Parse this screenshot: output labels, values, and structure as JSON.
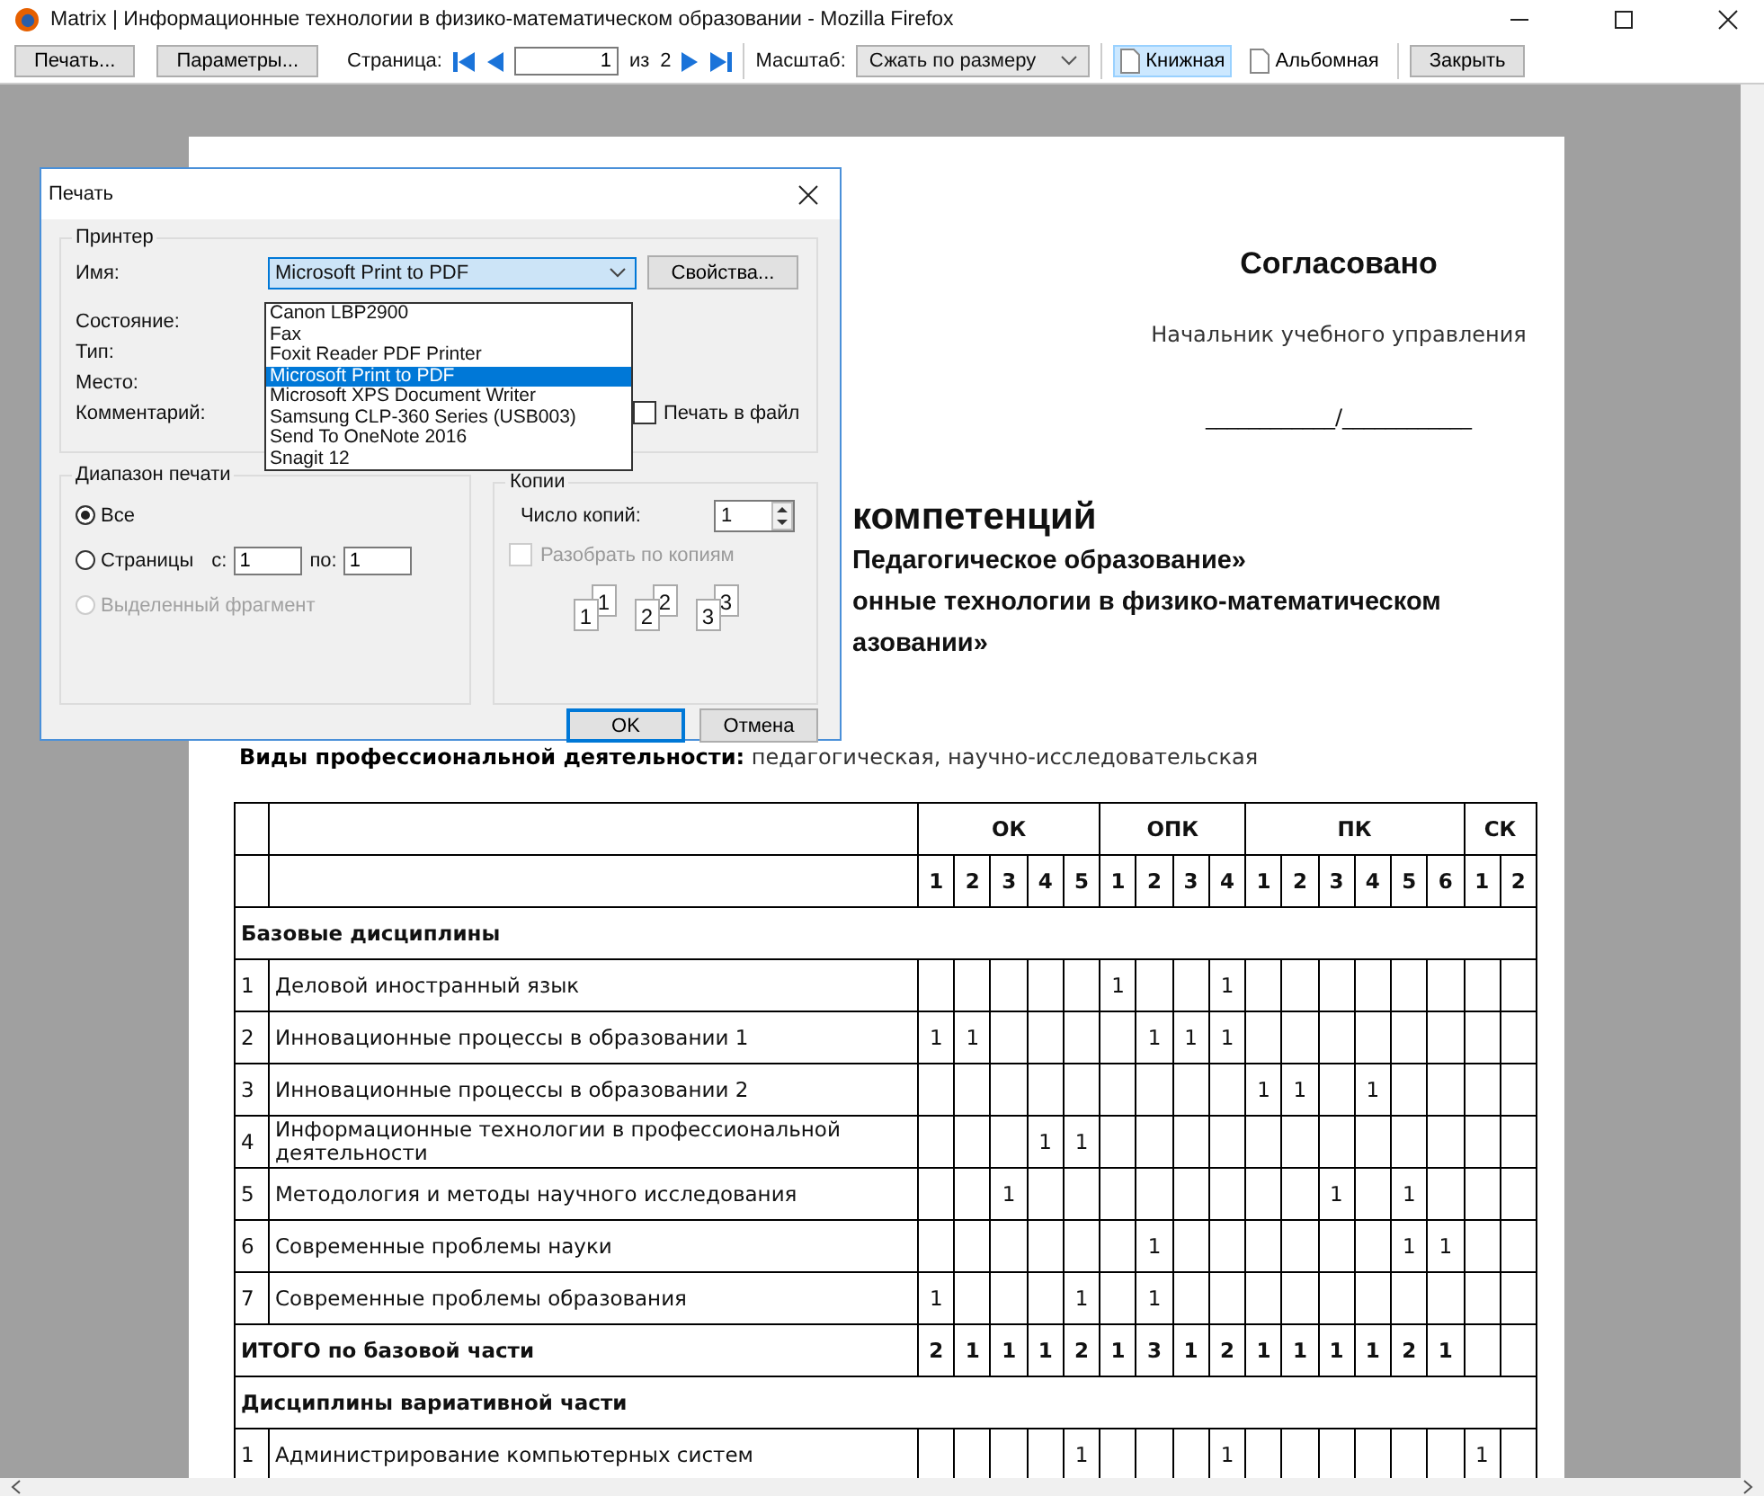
{
  "window": {
    "title": "Matrix | Информационные технологии в физико-математическом образовании - Mozilla Firefox"
  },
  "toolbar": {
    "print_button": "Печать...",
    "setup_button": "Параметры...",
    "page_label": "Страница:",
    "page_value": "1",
    "of_label": "из",
    "page_count": "2",
    "scale_label": "Масштаб:",
    "scale_value": "Сжать по размеру",
    "orientations": [
      {
        "label": "Книжная",
        "selected": true
      },
      {
        "label": "Альбомная",
        "selected": false
      }
    ],
    "close_button": "Закрыть"
  },
  "print_dialog": {
    "title": "Печать",
    "printer_group": "Принтер",
    "name_label": "Имя:",
    "printer": "Microsoft Print to PDF",
    "properties_button": "Свойства...",
    "info_labels": [
      "Состояние:",
      "Тип:",
      "Место:",
      "Комментарий:"
    ],
    "printer_options": [
      {
        "label": "Canon LBP2900",
        "selected": false
      },
      {
        "label": "Fax",
        "selected": false
      },
      {
        "label": "Foxit Reader PDF Printer",
        "selected": false
      },
      {
        "label": "Microsoft Print to PDF",
        "selected": true
      },
      {
        "label": "Microsoft XPS Document Writer",
        "selected": false
      },
      {
        "label": "Samsung CLP-360 Series (USB003)",
        "selected": false
      },
      {
        "label": "Send To OneNote 2016",
        "selected": false
      },
      {
        "label": "Snagit 12",
        "selected": false
      }
    ],
    "print_to_file": {
      "label": "Печать в файл",
      "checked": false
    },
    "range_group": "Диапазон печати",
    "range_options": [
      {
        "label": "Все",
        "selected": true,
        "disabled": false
      },
      {
        "label": "Страницы",
        "selected": false,
        "disabled": false
      },
      {
        "label": "Выделенный фрагмент",
        "selected": false,
        "disabled": true
      }
    ],
    "from_label": "с:",
    "from_value": "1",
    "to_label": "по:",
    "to_value": "1",
    "copies_group": "Копии",
    "copies_label": "Число копий:",
    "copies_value": "1",
    "collate": {
      "label": "Разобрать по копиям",
      "checked": false,
      "disabled": true
    },
    "collate_sets": [
      [
        "1",
        "1"
      ],
      [
        "2",
        "2"
      ],
      [
        "3",
        "3"
      ]
    ],
    "ok_button": "OK",
    "cancel_button": "Отмена"
  },
  "document": {
    "approval_title": "Согласовано",
    "approver": "Начальник учебного управления",
    "signature_line": "____________/____________",
    "heading_fragments": [
      "компетенций",
      "Педагогическое образование»",
      "онные технологии в физико-математическом",
      "азовании»"
    ],
    "activities": "**Виды профессиональной деятельности:** педагогическая, научно-исследовательская",
    "table": {
      "groups": [
        {
          "label": "ОК",
          "numbers": [
            "1",
            "2",
            "3",
            "4",
            "5"
          ]
        },
        {
          "label": "ОПК",
          "numbers": [
            "1",
            "2",
            "3",
            "4"
          ]
        },
        {
          "label": "ПК",
          "numbers": [
            "1",
            "2",
            "3",
            "4",
            "5",
            "6"
          ]
        },
        {
          "label": "СК",
          "numbers": [
            "1",
            "2"
          ]
        }
      ],
      "rows": [
        {
          "kind": "section",
          "label": "Базовые дисциплины"
        },
        {
          "kind": "item",
          "number": "1",
          "name": "Деловой иностранный язык",
          "cells": [
            null,
            null,
            null,
            null,
            null,
            "1",
            null,
            null,
            "1",
            null,
            null,
            null,
            null,
            null,
            null,
            null,
            null
          ]
        },
        {
          "kind": "item",
          "number": "2",
          "name": "Инновационные процессы в образовании 1",
          "cells": [
            "1",
            "1",
            null,
            null,
            null,
            null,
            "1",
            "1",
            "1",
            null,
            null,
            null,
            null,
            null,
            null,
            null,
            null
          ]
        },
        {
          "kind": "item",
          "number": "3",
          "name": "Инновационные процессы в образовании 2",
          "cells": [
            null,
            null,
            null,
            null,
            null,
            null,
            null,
            null,
            null,
            "1",
            "1",
            null,
            "1",
            null,
            null,
            null,
            null
          ]
        },
        {
          "kind": "item",
          "number": "4",
          "name": "Информационные технологии в профессиональной деятельности",
          "cells": [
            null,
            null,
            null,
            "1",
            "1",
            null,
            null,
            null,
            null,
            null,
            null,
            null,
            null,
            null,
            null,
            null,
            null
          ]
        },
        {
          "kind": "item",
          "number": "5",
          "name": "Методология и методы научного исследования",
          "cells": [
            null,
            null,
            "1",
            null,
            null,
            null,
            null,
            null,
            null,
            null,
            null,
            "1",
            null,
            "1",
            null,
            null,
            null
          ]
        },
        {
          "kind": "item",
          "number": "6",
          "name": "Современные проблемы науки",
          "cells": [
            null,
            null,
            null,
            null,
            null,
            null,
            "1",
            null,
            null,
            null,
            null,
            null,
            null,
            "1",
            "1",
            null,
            null
          ]
        },
        {
          "kind": "item",
          "number": "7",
          "name": "Современные проблемы образования",
          "cells": [
            "1",
            null,
            null,
            null,
            "1",
            null,
            "1",
            null,
            null,
            null,
            null,
            null,
            null,
            null,
            null,
            null,
            null
          ]
        },
        {
          "kind": "total",
          "label": "ИТОГО по базовой части",
          "cells": [
            "2",
            "1",
            "1",
            "1",
            "2",
            "1",
            "3",
            "1",
            "2",
            "1",
            "1",
            "1",
            "1",
            "2",
            "1",
            null,
            null
          ]
        },
        {
          "kind": "section",
          "label": "Дисциплины вариативной части"
        },
        {
          "kind": "item",
          "number": "1",
          "name": "Администрирование компьютерных систем",
          "cells": [
            null,
            null,
            null,
            null,
            "1",
            null,
            null,
            null,
            "1",
            null,
            null,
            null,
            null,
            null,
            null,
            "1",
            null
          ]
        }
      ]
    }
  }
}
